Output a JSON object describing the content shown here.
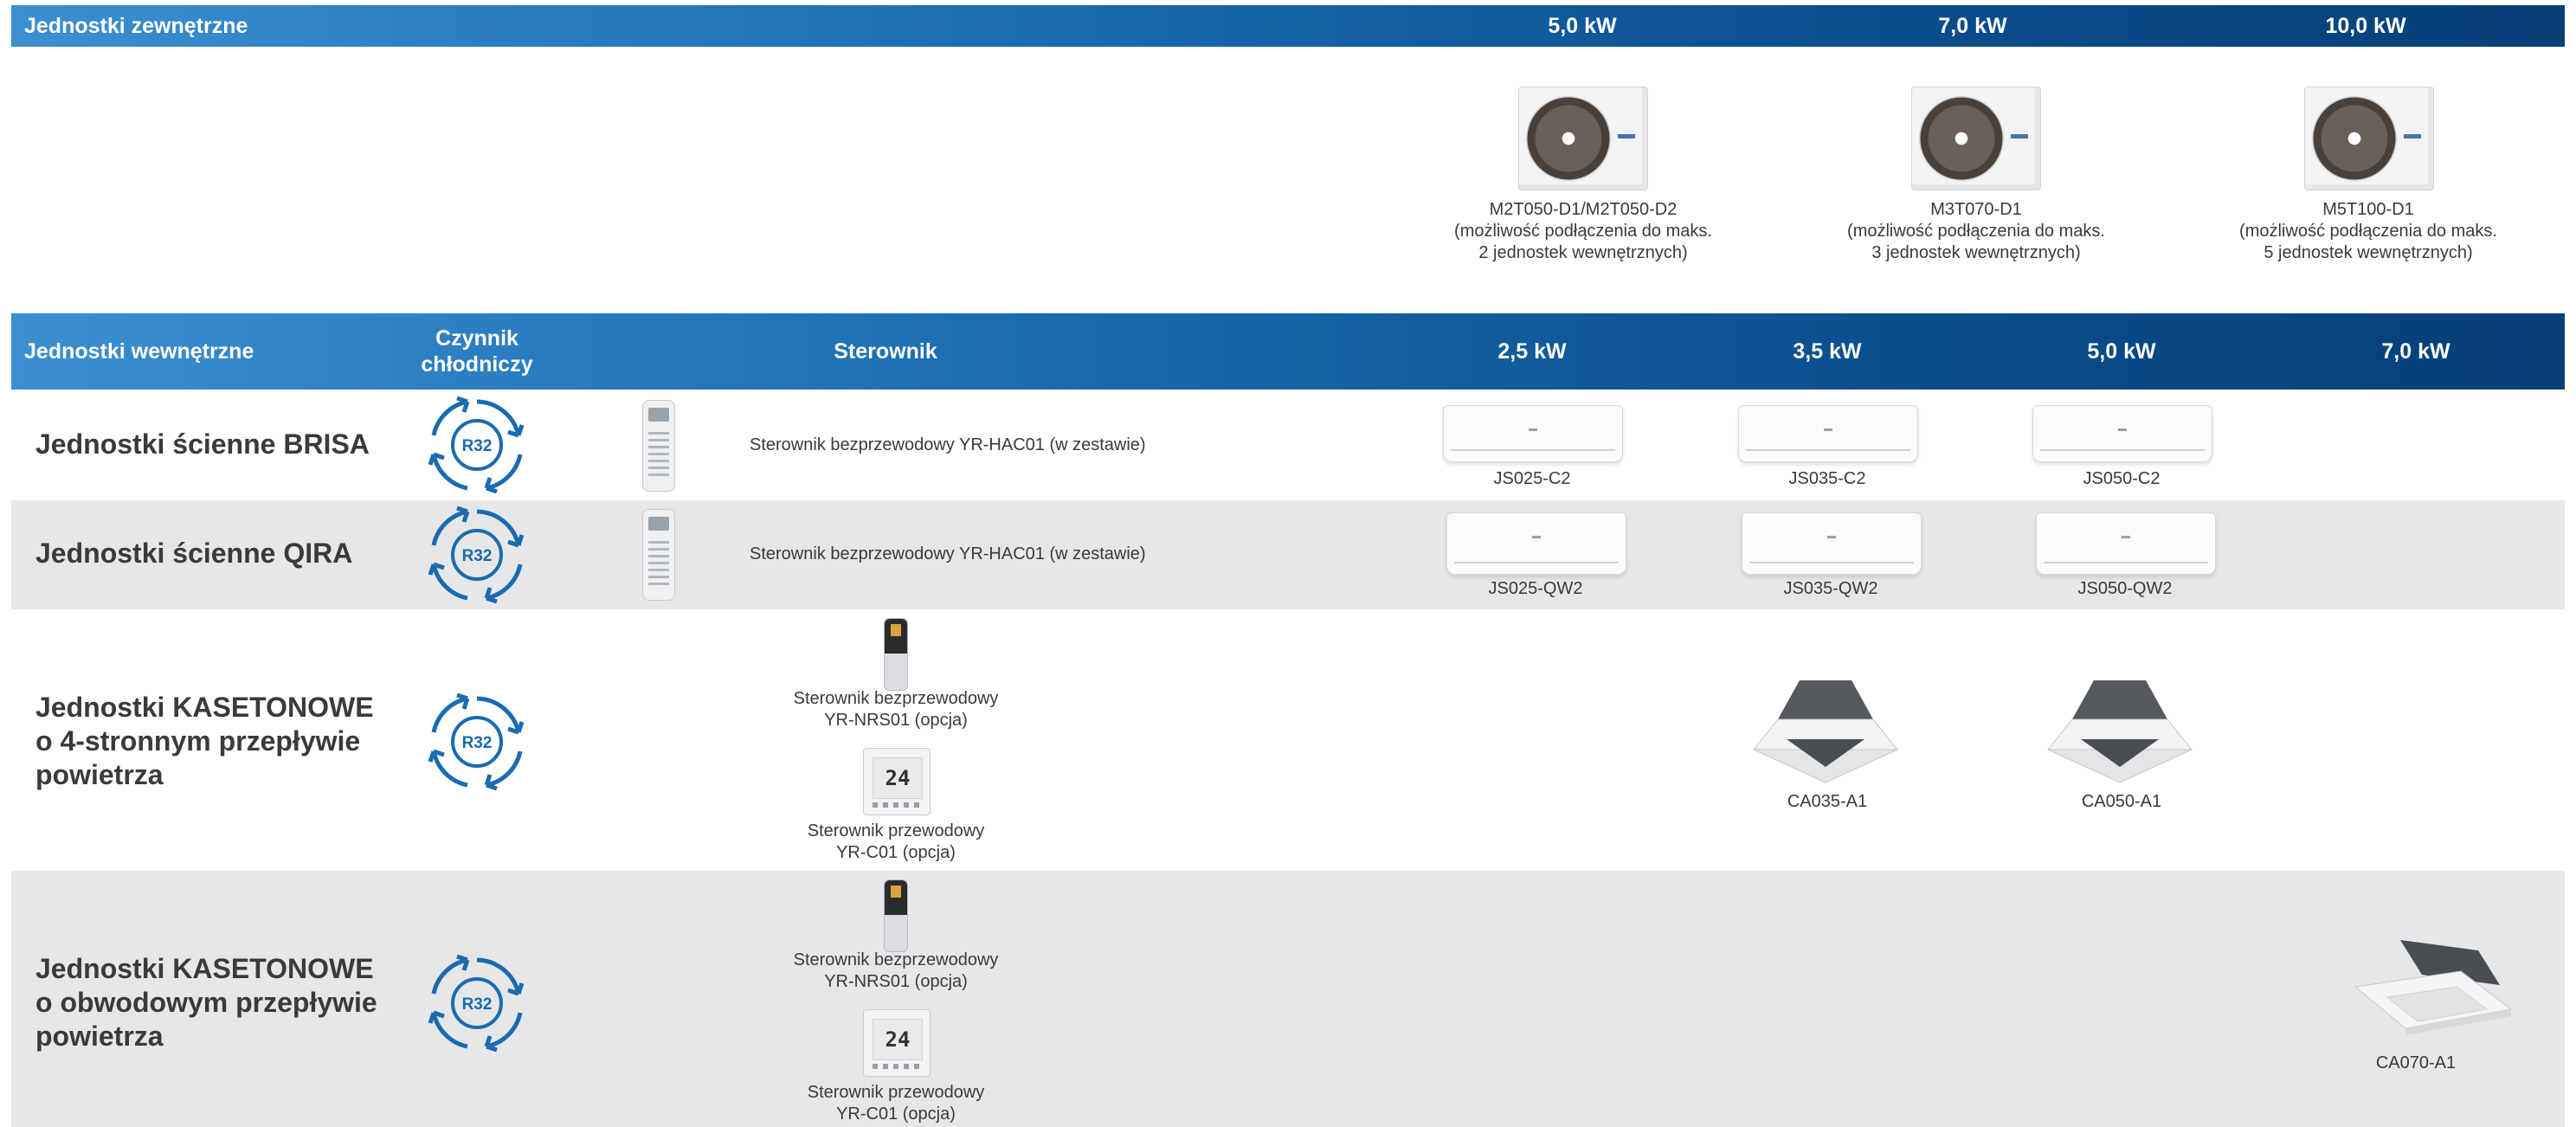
{
  "outdoor": {
    "header": {
      "title": "Jednostki zewnętrzne",
      "capacities": [
        "5,0 kW",
        "7,0 kW",
        "10,0 kW"
      ]
    },
    "units": [
      {
        "model": "M2T050-D1/M2T050-D2",
        "note_line1": "(możliwość podłączenia do maks.",
        "note_line2": "2 jednostek wewnętrznych)"
      },
      {
        "model": "M3T070-D1",
        "note_line1": "(możliwość podłączenia do maks.",
        "note_line2": "3 jednostek wewnętrznych)"
      },
      {
        "model": "M5T100-D1",
        "note_line1": "(możliwość podłączenia do  maks.",
        "note_line2": "5 jednostek wewnętrznych)"
      }
    ]
  },
  "indoor": {
    "header": {
      "title": "Jednostki wewnętrzne",
      "refrigerant_line1": "Czynnik",
      "refrigerant_line2": "chłodniczy",
      "controller": "Sterownik",
      "capacities": [
        "2,5 kW",
        "3,5 kW",
        "5,0 kW",
        "7,0 kW"
      ]
    },
    "refrigerant_badge": "R32",
    "rows": [
      {
        "title_line1": "Jednostki ścienne BRISA",
        "controller_text": "Sterownik bezprzewodowy YR-HAC01 (w zestawie)",
        "models": [
          "JS025-C2",
          "JS035-C2",
          "JS050-C2"
        ]
      },
      {
        "title_line1": "Jednostki ścienne QIRA",
        "controller_text": "Sterownik bezprzewodowy YR-HAC01 (w zestawie)",
        "models": [
          "JS025-QW2",
          "JS035-QW2",
          "JS050-QW2"
        ]
      },
      {
        "title_line1": "Jednostki KASETONOWE",
        "title_line2": "o 4-stronnym przepływie",
        "title_line3": "powietrza",
        "wireless_line1": "Sterownik bezprzewodowy",
        "wireless_line2": "YR-NRS01 (opcja)",
        "wired_line1": "Sterownik przewodowy",
        "wired_line2": "YR-C01 (opcja)",
        "wired_display": "24",
        "models": [
          "CA035-A1",
          "CA050-A1"
        ]
      },
      {
        "title_line1": "Jednostki KASETONOWE",
        "title_line2": "o obwodowym przepływie",
        "title_line3": "powietrza",
        "wireless_line1": "Sterownik bezprzewodowy",
        "wireless_line2": "YR-NRS01 (opcja)",
        "wired_line1": "Sterownik przewodowy",
        "wired_line2": "YR-C01 (opcja)",
        "wired_display": "24",
        "models": [
          "CA070-A1"
        ]
      }
    ]
  },
  "colors": {
    "header_start": "#3b8fd0",
    "header_end": "#073f78",
    "row_gray": "#e6e7e9",
    "badge_blue": "#1a6bb0"
  }
}
